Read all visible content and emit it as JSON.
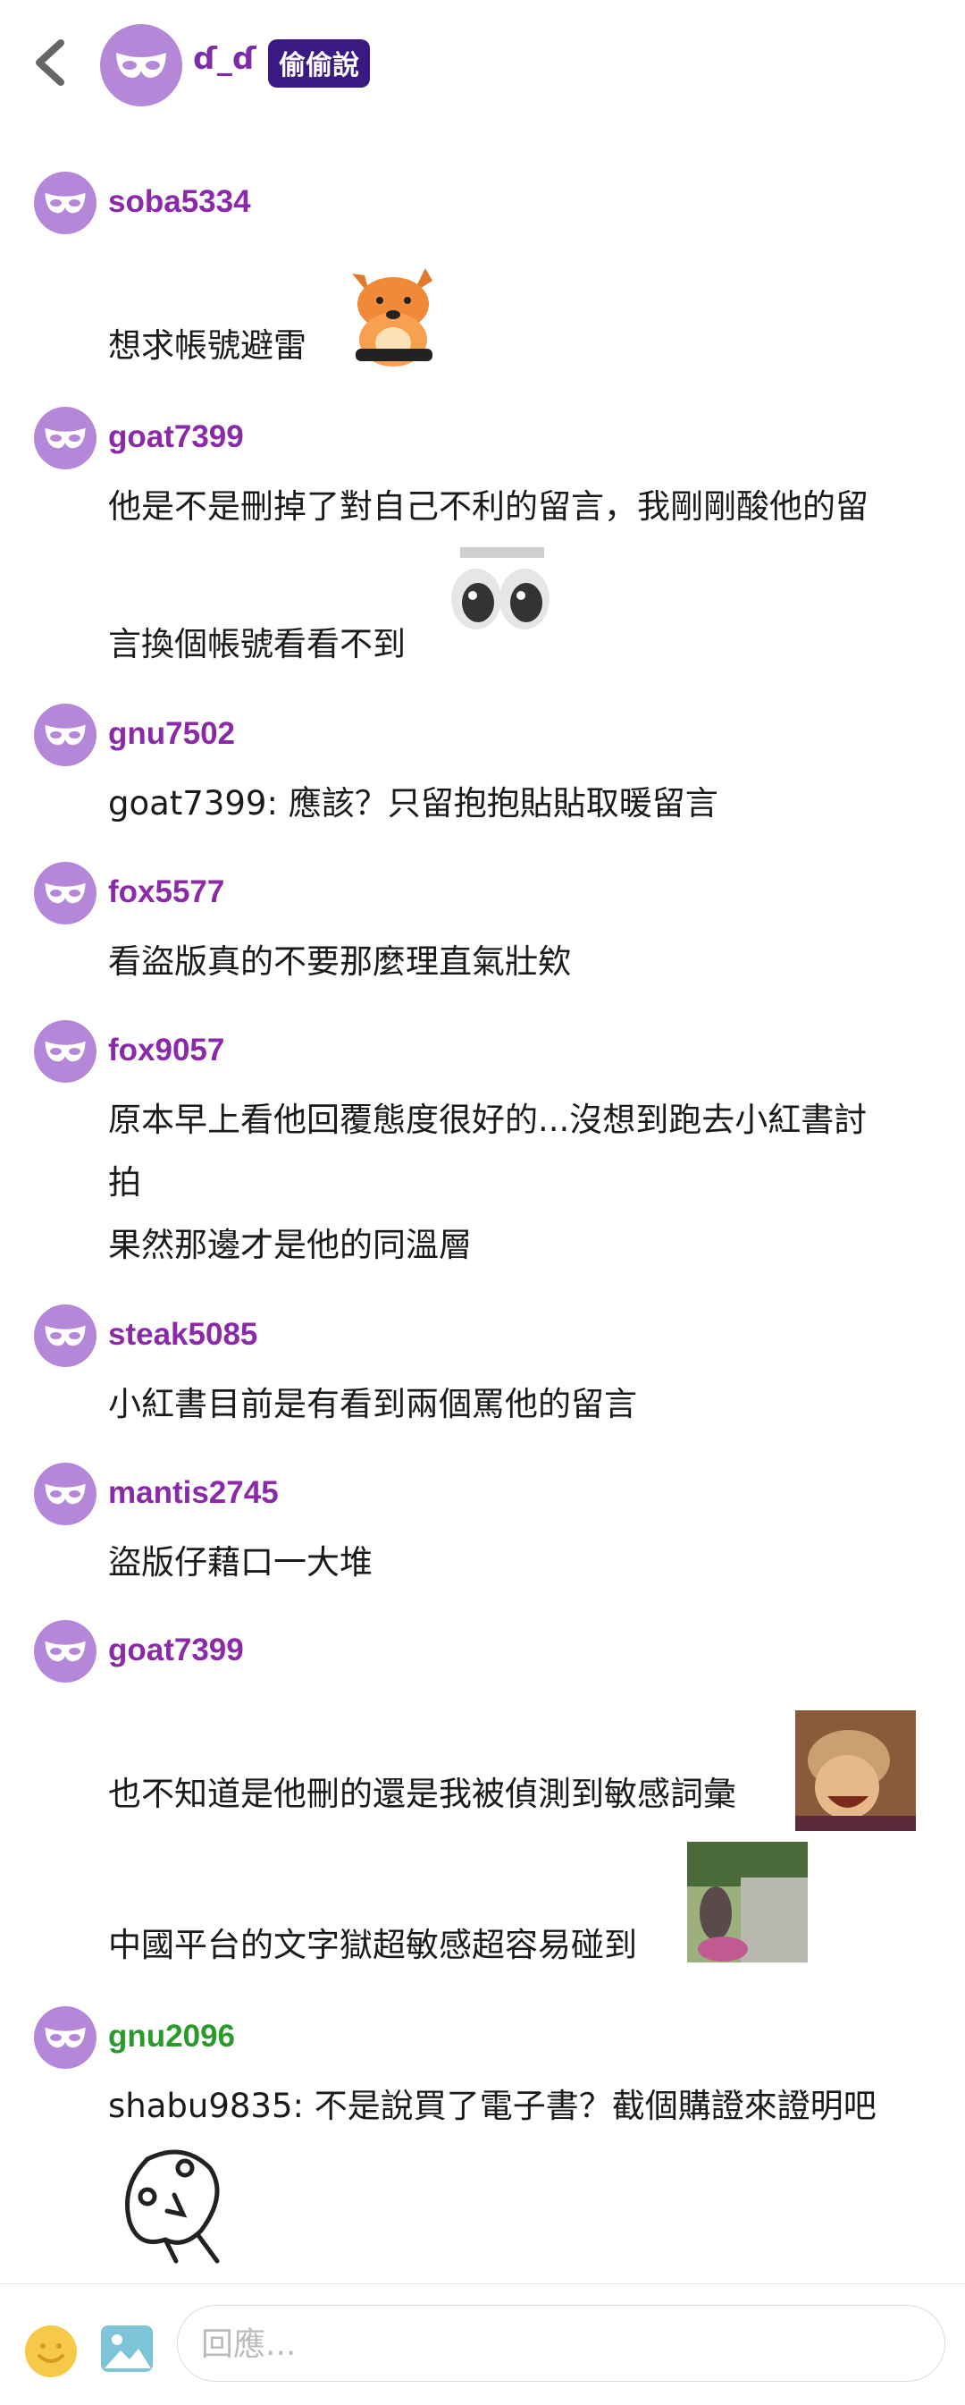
{
  "header": {
    "name": "ɗ_ɗ",
    "badge": "偷偷說"
  },
  "comments": [
    {
      "user": "soba5334",
      "lines": [
        "想求帳號避雷"
      ]
    },
    {
      "user": "goat7399",
      "lines": [
        "他是不是刪掉了對自己不利的留言，我剛剛酸他的留",
        "言換個帳號看看不到"
      ]
    },
    {
      "user": "gnu7502",
      "lines": [
        "goat7399: 應該？只留抱抱貼貼取暖留言"
      ]
    },
    {
      "user": "fox5577",
      "lines": [
        "看盜版真的不要那麼理直氣壯欸"
      ]
    },
    {
      "user": "fox9057",
      "lines": [
        "原本早上看他回覆態度很好的...沒想到跑去小紅書討",
        "拍",
        "果然那邊才是他的同溫層"
      ]
    },
    {
      "user": "steak5085",
      "lines": [
        "小紅書目前是有看到兩個罵他的留言"
      ]
    },
    {
      "user": "mantis2745",
      "lines": [
        "盜版仔藉口一大堆"
      ]
    },
    {
      "user": "goat7399",
      "lines": [
        "也不知道是他刪的還是我被偵測到敏感詞彙",
        "中國平台的文字獄超敏感超容易碰到"
      ]
    },
    {
      "user": "gnu2096",
      "lines": [
        "shabu9835: 不是說買了電子書？截個購證來證明吧"
      ]
    }
  ],
  "reply": {
    "placeholder": "回應..."
  },
  "colors": {
    "username": "#8a2aa8",
    "username_highlight": "#2a9a2a",
    "avatar": "#b487d8",
    "badge": "#3a1a82"
  }
}
